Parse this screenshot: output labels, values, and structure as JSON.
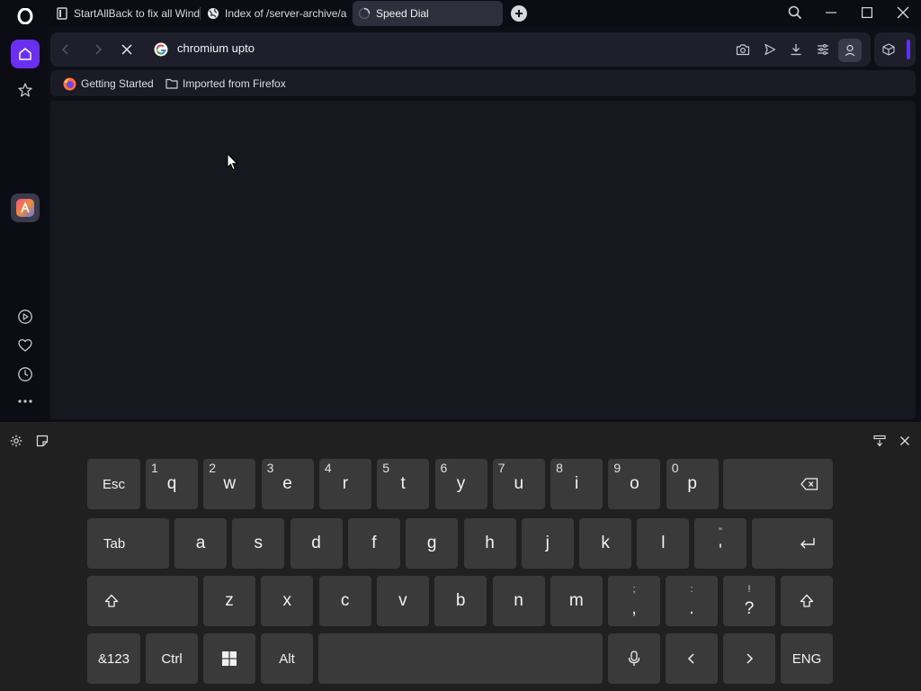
{
  "tabs": [
    {
      "title": "StartAllBack to fix all Wind",
      "icon": "book-icon"
    },
    {
      "title": "Index of /server-archive/a",
      "icon": "globe-icon"
    },
    {
      "title": "Speed Dial",
      "icon": "loading-spinner-icon",
      "active": true
    }
  ],
  "address_bar": {
    "value": "chromium upto",
    "search_engine_icon": "google-icon"
  },
  "bookmarks": [
    {
      "label": "Getting Started",
      "icon": "firefox-icon"
    },
    {
      "label": "Imported from Firefox",
      "icon": "folder-icon"
    }
  ],
  "sidebar": {
    "items": [
      "opera-logo",
      "home-icon",
      "bookmarks-star-icon",
      "aria-ai-icon",
      "player-icon",
      "heart-icon",
      "history-icon",
      "more-icon"
    ]
  },
  "keyboard": {
    "row1": [
      {
        "label": "Esc"
      },
      {
        "label": "q",
        "alt": "1"
      },
      {
        "label": "w",
        "alt": "2"
      },
      {
        "label": "e",
        "alt": "3"
      },
      {
        "label": "r",
        "alt": "4"
      },
      {
        "label": "t",
        "alt": "5"
      },
      {
        "label": "y",
        "alt": "6"
      },
      {
        "label": "u",
        "alt": "7"
      },
      {
        "label": "i",
        "alt": "8"
      },
      {
        "label": "o",
        "alt": "9"
      },
      {
        "label": "p",
        "alt": "0"
      }
    ],
    "row2": [
      {
        "label": "Tab"
      },
      {
        "label": "a"
      },
      {
        "label": "s"
      },
      {
        "label": "d"
      },
      {
        "label": "f"
      },
      {
        "label": "g"
      },
      {
        "label": "h"
      },
      {
        "label": "j"
      },
      {
        "label": "k"
      },
      {
        "label": "l"
      },
      {
        "label": "'",
        "top": "\""
      }
    ],
    "row3": [
      {
        "label": "z"
      },
      {
        "label": "x"
      },
      {
        "label": "c"
      },
      {
        "label": "v"
      },
      {
        "label": "b"
      },
      {
        "label": "n"
      },
      {
        "label": "m"
      },
      {
        "label": ",",
        "top": ";"
      },
      {
        "label": ".",
        "top": ":"
      },
      {
        "label": "?",
        "top": "!"
      }
    ],
    "row4": {
      "symbols": "&123",
      "ctrl": "Ctrl",
      "alt": "Alt",
      "lang": "ENG"
    }
  }
}
